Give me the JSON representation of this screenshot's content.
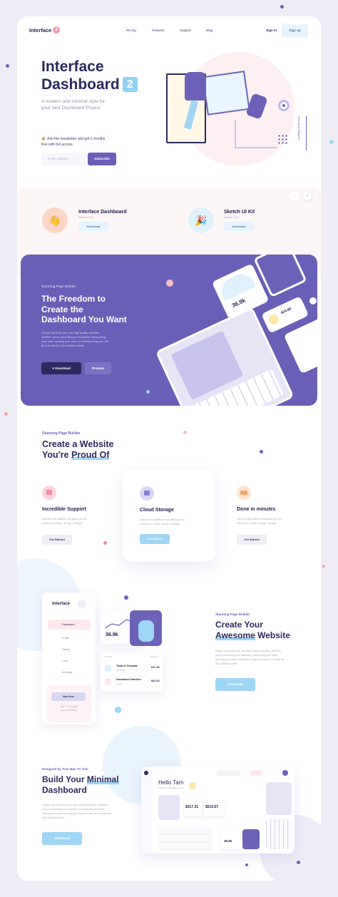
{
  "nav": {
    "logo": "Interface",
    "logo_badge": "2",
    "links": [
      "Pricing",
      "Features",
      "Support",
      "Blog"
    ],
    "signin": "Sign In",
    "signup": "Sign up"
  },
  "hero": {
    "title_line1": "Interface",
    "title_line2": "Dashboard",
    "badge": "2",
    "subtitle_line1": "A modern and minimal style for",
    "subtitle_line2": "your next Dashboard Project.",
    "newsletter_line1": "🎉 Join the newsletter and get 2 months",
    "newsletter_line2": "free with full access.",
    "email_placeholder": "Email address",
    "subscribe": "Subscribe",
    "side_label": "See more features"
  },
  "products": [
    {
      "title": "Interface Dashboard",
      "sub": "Version 1.0.0",
      "button": "Download",
      "emoji": "👋"
    },
    {
      "title": "Sketch UI Kit",
      "sub": "Version 1.0.0",
      "button": "Download",
      "emoji": "🎉"
    }
  ],
  "builder": {
    "eyebrow": "Stunning Page Builder",
    "title_line1": "The Freedom to",
    "title_line2": "Create the",
    "title_line3": "Dashboard You Want",
    "desc_line1": "Design and build your own high-quality websites.",
    "desc_line2": "Whether you're promoting your business, showcasing",
    "desc_line3": "your work, opening your store or starting a blog-you can",
    "desc_line4": "do it all with the Wix website builder.",
    "download": "Download",
    "preview": "Preview",
    "stat1": "36.9k",
    "stat2": "$24.89"
  },
  "website": {
    "eyebrow": "Stunning Page Builder",
    "title_line1": "Create a Website",
    "title_line2_a": "You're ",
    "title_line2_b": "Proud Of"
  },
  "features": [
    {
      "title": "Incredible Support",
      "desc_line1": "Discover the platform that gives you the",
      "desc_line2": "freedom to create, design, manage.",
      "button": "Get Started"
    },
    {
      "title": "Cloud Storage",
      "desc_line1": "Discover the platform that gives you the",
      "desc_line2": "freedom to create, design, manage.",
      "button": "Get Started"
    },
    {
      "title": "Done in minutes",
      "desc_line1": "Discover the platform that gives you the",
      "desc_line2": "freedom to create, design, manage.",
      "button": "Get Started"
    }
  ],
  "awesome": {
    "eyebrow": "Stunning Page Builder",
    "title_line1": "Create Your",
    "title_line2_a": "Awesome",
    "title_line2_b": " Website",
    "desc_line1": "Design and build your own high-quality websites. Whether",
    "desc_line2": "you're promoting your business, showcasing your work,",
    "desc_line3": "opening your store or starting a blog-you can do it all with the",
    "desc_line4": "Wix website builder.",
    "download": "Download"
  },
  "mock1": {
    "brand": "Interface",
    "menu": [
      "Dashboard",
      "Profile",
      "Setting",
      "Chart",
      "Message"
    ],
    "new_item": "New Item",
    "hint_line1": "Click \"+\" to create",
    "hint_line2": "your new Items",
    "stat": "36.9k",
    "col1": "Product",
    "col2": "Earning",
    "rows": [
      {
        "name": "Thalia 8 Template",
        "sub": "Sketch Kit",
        "value": "$17.38"
      },
      {
        "name": "Dashboard Interface",
        "sub": "Figma",
        "value": "$31.63"
      }
    ]
  },
  "minimal": {
    "eyebrow": "Designed by Tran Mau Tri Tam",
    "title_line1_a": "Build Your ",
    "title_line1_b": "Minimal",
    "title_line2": "Dashboard",
    "desc_line1": "Design and build your own high-quality websites. Whether",
    "desc_line2": "you're promoting your business, showcasing your work,",
    "desc_line3": "opening your store or starting a blog-you can do it all with the",
    "desc_line4": "Wix website builder.",
    "download": "Download"
  },
  "mock2": {
    "greeting": "Hello Tam",
    "sub": "Check in everthing at work",
    "v1": "$317.31",
    "v2": "$510.67",
    "stat": "36.9k"
  },
  "colors": {
    "primary": "#6c63b8",
    "purple_dark": "#2b2a5c",
    "light_blue": "#9fd6f5",
    "pink": "#f8c8d6"
  }
}
